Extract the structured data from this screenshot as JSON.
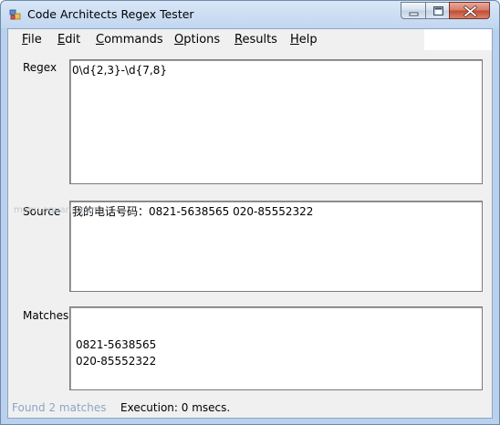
{
  "window": {
    "title": "Code Architects Regex Tester"
  },
  "menu": {
    "items": [
      {
        "underline": "F",
        "rest": "ile"
      },
      {
        "underline": "E",
        "rest": "dit"
      },
      {
        "underline": "C",
        "rest": "ommands"
      },
      {
        "underline": "O",
        "rest": "ptions"
      },
      {
        "underline": "R",
        "rest": "esults"
      },
      {
        "underline": "H",
        "rest": "elp"
      }
    ]
  },
  "regex": {
    "label": "Regex",
    "value": "0\\d{2,3}-\\d{7,8}"
  },
  "source": {
    "label": "Source",
    "value": "我的电话号码：0821-5638565 020-85552322"
  },
  "matches": {
    "label": "Matches",
    "lines": [
      "0821-5638565",
      "020-85552322"
    ]
  },
  "status": {
    "found": "Found 2 matches",
    "execution": "Execution: 0 msecs."
  },
  "watermark": "manu.aquariu.com",
  "colors": {
    "titlebar": "#c7dbf2",
    "client": "#f0f0f0",
    "status_found": "#8aa6c8"
  },
  "icons": {
    "app": "app-icon",
    "minimize": "minimize-icon",
    "maximize": "maximize-icon",
    "close": "close-icon"
  }
}
